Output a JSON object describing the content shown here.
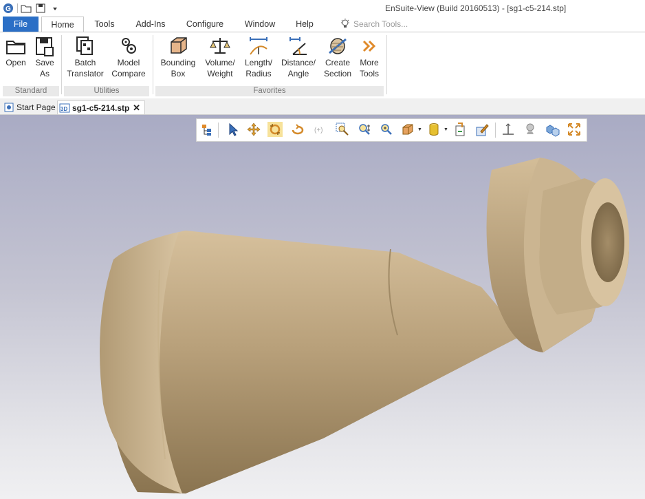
{
  "app": {
    "title": "EnSuite-View (Build 20160513) - [sg1-c5-214.stp]"
  },
  "quick_access": {
    "icons": [
      "app-logo-icon",
      "open-folder-icon",
      "save-as-icon",
      "customize-dropdown-icon"
    ]
  },
  "menu": {
    "tabs": [
      "File",
      "Home",
      "Tools",
      "Add-Ins",
      "Configure",
      "Window",
      "Help"
    ],
    "active_tab": "Home",
    "search_placeholder": "Search Tools..."
  },
  "ribbon": {
    "groups": [
      {
        "label": "Standard",
        "buttons": [
          {
            "label": "Open"
          },
          {
            "label": "Save\nAs"
          }
        ]
      },
      {
        "label": "Utilities",
        "buttons": [
          {
            "label": "Batch\nTranslator"
          },
          {
            "label": "Model\nCompare"
          }
        ]
      },
      {
        "label": "Favorites",
        "buttons": [
          {
            "label": "Bounding\nBox"
          },
          {
            "label": "Volume/\nWeight"
          },
          {
            "label": "Length/\nRadius"
          },
          {
            "label": "Distance/\nAngle"
          },
          {
            "label": "Create\nSection"
          },
          {
            "label": "More\nTools"
          }
        ]
      }
    ]
  },
  "documents": {
    "tabs": [
      {
        "label": "Start Page",
        "icon": "start-page-icon",
        "active": false
      },
      {
        "label": "sg1-c5-214.stp",
        "icon": "3d-model-icon",
        "active": true
      }
    ],
    "close_label": "✕"
  },
  "view_toolbar": {
    "tools": [
      "model-tree-icon",
      "select-arrow-icon",
      "pan-icon",
      "orbit-icon",
      "rotate-icon",
      "zoom-step-icon",
      "zoom-window-icon",
      "zoom-selection-icon",
      "zoom-fit-icon",
      "view-cube-icon",
      "shading-cylinder-icon",
      "import-icon",
      "edit-markup-icon",
      "axis-icon",
      "light-icon",
      "explode-icon",
      "fullscreen-icon"
    ],
    "selected": "orbit-icon"
  },
  "colors": {
    "file_tab": "#2b6fc6",
    "model_light": "#d9c3a0",
    "model_dark": "#8c7550",
    "background_top": "#a9abc4",
    "background_bottom": "#f0f0f2",
    "selected_tool": "#f7e29a"
  }
}
